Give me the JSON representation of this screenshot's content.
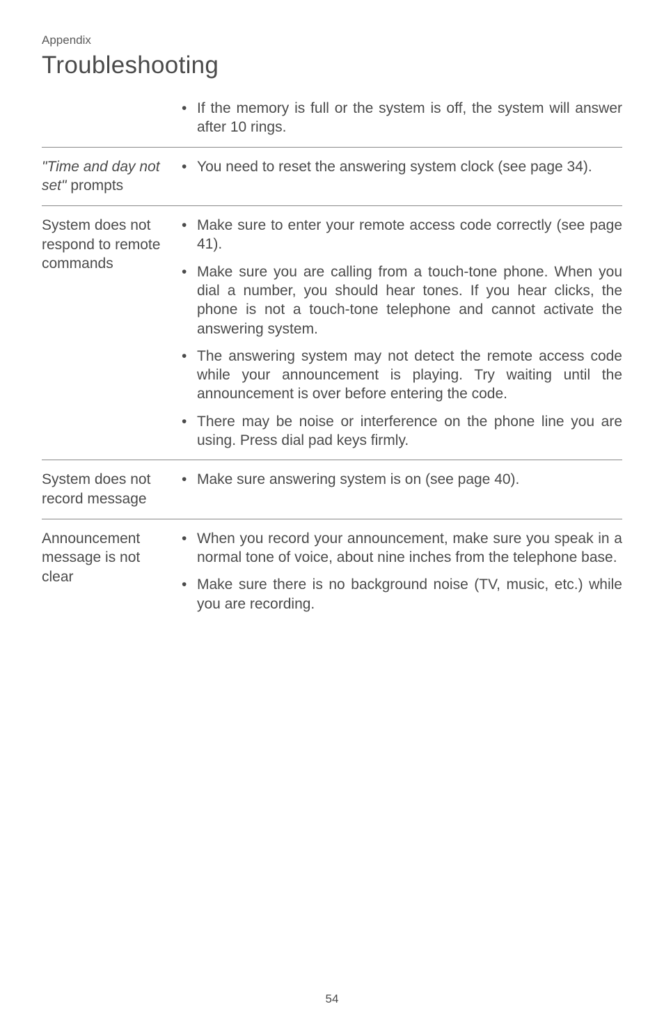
{
  "header": {
    "appendix": "Appendix",
    "title": "Troubleshooting"
  },
  "sections": [
    {
      "label_italic": "",
      "label_plain": "",
      "items": [
        "If the memory is full or the system is off, the system will answer after 10 rings."
      ]
    },
    {
      "label_italic": "\"Time and day not set\"",
      "label_plain": "prompts",
      "items": [
        "You need to reset the answering system clock (see page 34)."
      ]
    },
    {
      "label_italic": "",
      "label_plain": "System does not respond to remote commands",
      "items": [
        "Make sure to enter your remote access code correctly (see page 41).",
        "Make sure you are calling from a touch-tone phone. When you dial a number, you should hear tones. If you hear clicks, the phone is not a touch-tone telephone and cannot activate the answering system.",
        "The answering system may not detect the remote access code while your announcement is playing. Try waiting until the announcement is over before entering the code.",
        "There may be noise or interference on the phone line you are using. Press dial pad keys firmly."
      ]
    },
    {
      "label_italic": "",
      "label_plain": "System does not record message",
      "items": [
        "Make sure answering system is on (see page 40)."
      ]
    },
    {
      "label_italic": "",
      "label_plain": "Announcement message is not clear",
      "items": [
        "When you record your announcement, make sure you speak in a normal tone of voice, about nine inches from the telephone base.",
        "Make sure there is no background noise (TV, music, etc.) while you are recording."
      ]
    }
  ],
  "page_number": "54"
}
